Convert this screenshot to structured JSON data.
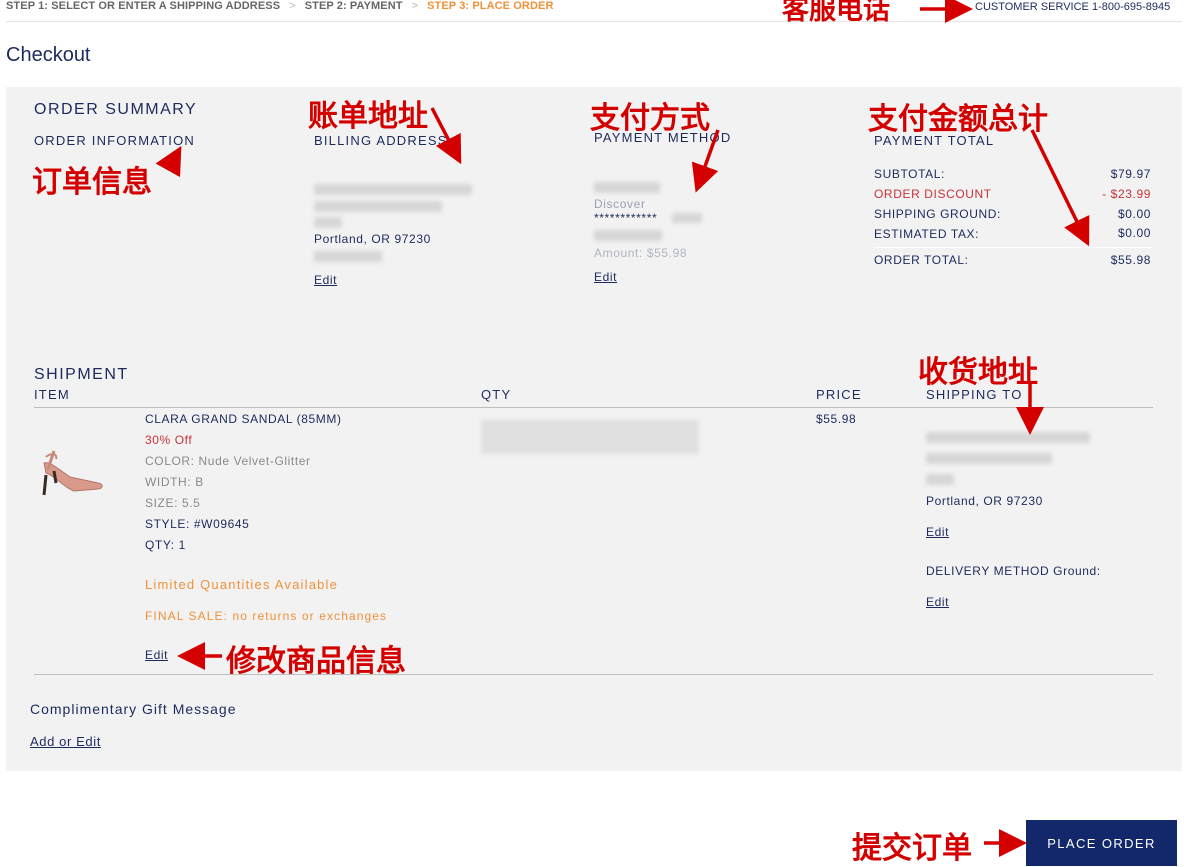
{
  "steps": {
    "step1": "STEP 1: SELECT OR ENTER A SHIPPING ADDRESS",
    "sep": ">",
    "step2": "STEP 2: PAYMENT",
    "step3": "STEP 3: PLACE ORDER"
  },
  "customer_service": "CUSTOMER SERVICE 1-800-695-8945",
  "page_title": "Checkout",
  "summary": {
    "heading": "ORDER SUMMARY",
    "order_information": "ORDER INFORMATION",
    "billing_address": {
      "label": "BILLING ADDRESS",
      "city": "Portland, OR 97230",
      "edit": "Edit"
    },
    "payment_method": {
      "label": "PAYMENT METHOD",
      "card_type": "Discover",
      "card_number": "************",
      "amount": "Amount: $55.98",
      "edit": "Edit"
    },
    "payment_total": {
      "label": "PAYMENT TOTAL",
      "rows": [
        {
          "name": "SUBTOTAL:",
          "value": "$79.97"
        },
        {
          "name": "ORDER DISCOUNT",
          "value": "- $23.99"
        },
        {
          "name": "SHIPPING GROUND:",
          "value": "$0.00"
        },
        {
          "name": "ESTIMATED TAX:",
          "value": "$0.00"
        }
      ],
      "total_name": "ORDER TOTAL:",
      "total_value": "$55.98"
    }
  },
  "shipment": {
    "heading": "SHIPMENT",
    "columns": {
      "item": "ITEM",
      "qty": "QTY",
      "price": "PRICE",
      "shipping_to": "SHIPPING TO"
    },
    "item": {
      "name": "CLARA GRAND SANDAL (85MM)",
      "discount": "30% Off",
      "color": "COLOR: Nude Velvet-Glitter",
      "width": "WIDTH: B",
      "size": "SIZE: 5.5",
      "style": "STYLE: #W09645",
      "qty": "QTY: 1",
      "limited": "Limited Quantities Available",
      "final_sale": "FINAL SALE: no returns or exchanges",
      "edit": "Edit",
      "price": "$55.98"
    },
    "shipping": {
      "city": "Portland, OR 97230",
      "edit": "Edit",
      "delivery_method": "DELIVERY METHOD Ground:",
      "delivery_edit": "Edit"
    }
  },
  "gift": {
    "title": "Complimentary Gift Message",
    "link": "Add or Edit"
  },
  "place_order": "PLACE ORDER",
  "annotations": {
    "customer_service": "客服电话",
    "order_info": "订单信息",
    "billing": "账单地址",
    "payment": "支付方式",
    "total": "支付金额总计",
    "shipping": "收货地址",
    "edit_item": "修改商品信息",
    "submit": "提交订单"
  },
  "colors": {
    "navy": "#1d2a5c",
    "accent": "#f0913a",
    "discount_red": "#c8323a",
    "annotation_red": "#d40000",
    "button": "#12286b"
  }
}
